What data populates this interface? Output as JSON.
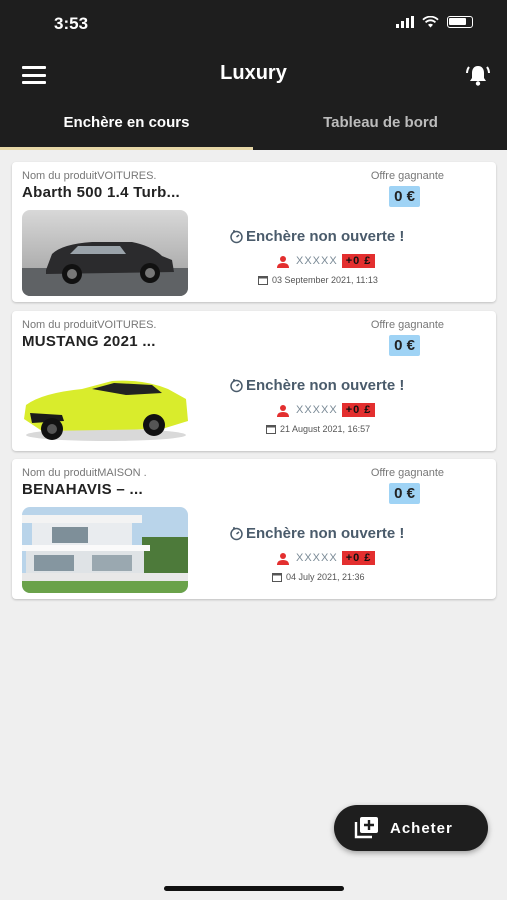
{
  "status_bar": {
    "time": "3:53"
  },
  "app_bar": {
    "title": "Luxury",
    "menu_icon": "hamburger-icon",
    "notification_icon": "bell-ringing-icon"
  },
  "tabs": [
    {
      "label": "Enchère en cours",
      "active": true
    },
    {
      "label": "Tableau de bord",
      "active": false
    }
  ],
  "colors": {
    "header_bg": "#1e1e1e",
    "tab_indicator": "#e6d7a7",
    "offer_badge": "#9fd3f5",
    "bid_chip": "#e32f2f"
  },
  "auctions": [
    {
      "product_line": "Nom du produitVOITURES.",
      "title": "Abarth 500 1.4 Turb...",
      "offer_label": "Offre gagnante",
      "offer_value": "0 €",
      "status": "Enchère non ouverte !",
      "bidder": "XXXXX",
      "bid": "+0 £",
      "date": "03 September  2021, 11:13",
      "image": "dark-grey-abarth-500-car"
    },
    {
      "product_line": "Nom du produitVOITURES.",
      "title": "MUSTANG 2021 ...",
      "offer_label": "Offre gagnante",
      "offer_value": "0 €",
      "status": "Enchère non ouverte !",
      "bidder": "XXXXX",
      "bid": "+0 £",
      "date": "21 August  2021, 16:57",
      "image": "yellow-mustang-car"
    },
    {
      "product_line": "Nom du produitMAISON .",
      "title": "BENAHAVIS – ...",
      "offer_label": "Offre gagnante",
      "offer_value": "0 €",
      "status": "Enchère non ouverte !",
      "bidder": "XXXXX",
      "bid": "+0 £",
      "date": "04 July  2021, 21:36",
      "image": "modern-white-villa"
    }
  ],
  "fab": {
    "label": "Acheter",
    "icon": "add-to-library-icon"
  }
}
